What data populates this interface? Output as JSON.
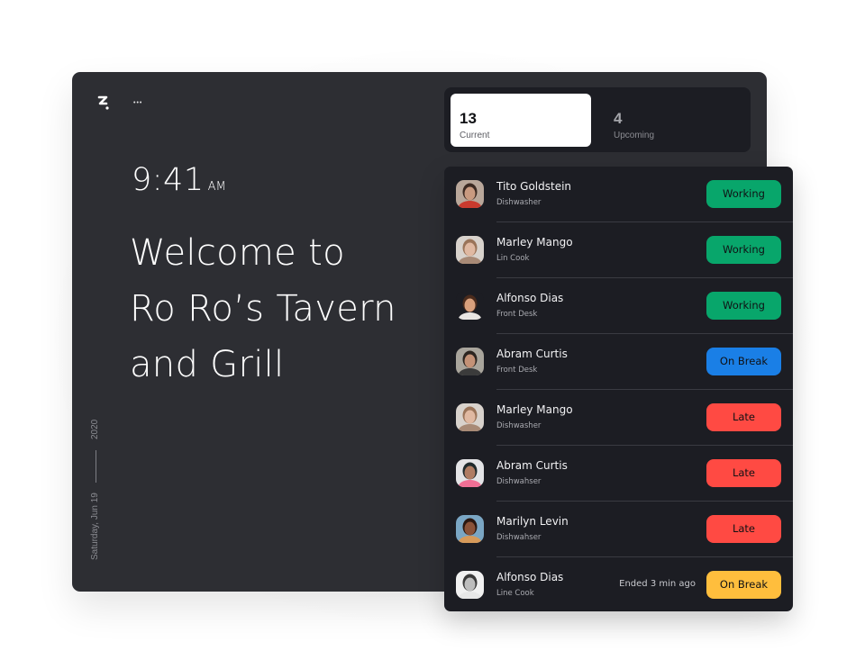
{
  "app": {
    "logo_icon": "brand-logo-icon",
    "menu_icon": "more-horizontal-icon",
    "menu_label": "•••"
  },
  "clock": {
    "time": "9:41",
    "ampm": "AM"
  },
  "welcome": {
    "line1": "Welcome to",
    "line2": "Ro Ro’s Tavern",
    "line3": "and Grill"
  },
  "date": {
    "year": "2020",
    "day": "Saturday, Jun 19"
  },
  "tabs": [
    {
      "count": "13",
      "label": "Current",
      "selected": true
    },
    {
      "count": "4",
      "label": "Upcoming",
      "selected": false
    }
  ],
  "status_colors": {
    "Working": "#08a66b",
    "On Break (blue)": "#1a7fe6",
    "Late": "#ff4a43",
    "On Break (yellow)": "#ffbe3d"
  },
  "staff": [
    {
      "name": "Tito Goldstein",
      "role": "Dishwasher",
      "meta": "",
      "status": "Working",
      "color": "#08a66b",
      "avatar": {
        "bg": "#b9a79a",
        "skin": "#c99a80",
        "hair": "#3c2a22",
        "shirt": "#c93a2e"
      }
    },
    {
      "name": "Marley Mango",
      "role": "Lin Cook",
      "meta": "",
      "status": "Working",
      "color": "#08a66b",
      "avatar": {
        "bg": "#d8d2cc",
        "skin": "#e0b9a2",
        "hair": "#9a7459",
        "shirt": "#a88a76"
      }
    },
    {
      "name": "Alfonso Dias",
      "role": "Front Desk",
      "meta": "",
      "status": "Working",
      "color": "#08a66b",
      "avatar": {
        "bg": "#1c1d23",
        "skin": "#d9a07c",
        "hair": "#4a2b1c",
        "shirt": "#e9e6e3"
      }
    },
    {
      "name": "Abram Curtis",
      "role": "Front Desk",
      "meta": "",
      "status": "On Break",
      "color": "#1a7fe6",
      "avatar": {
        "bg": "#a9a59c",
        "skin": "#c49277",
        "hair": "#2c2520",
        "shirt": "#3b3b3b"
      }
    },
    {
      "name": "Marley Mango",
      "role": "Dishwasher",
      "meta": "",
      "status": "Late",
      "color": "#ff4a43",
      "avatar": {
        "bg": "#d8d2cc",
        "skin": "#e0b9a2",
        "hair": "#9a7459",
        "shirt": "#a88a76"
      }
    },
    {
      "name": "Abram Curtis",
      "role": "Dishwahser",
      "meta": "",
      "status": "Late",
      "color": "#ff4a43",
      "avatar": {
        "bg": "#e4e4e6",
        "skin": "#b07c62",
        "hair": "#1f2a2c",
        "shirt": "#f06f95"
      }
    },
    {
      "name": "Marilyn Levin",
      "role": "Dishwahser",
      "meta": "",
      "status": "Late",
      "color": "#ff4a43",
      "avatar": {
        "bg": "#7aa6c4",
        "skin": "#8a5238",
        "hair": "#2a1710",
        "shirt": "#d79a5a"
      }
    },
    {
      "name": "Alfonso Dias",
      "role": "Line Cook",
      "meta": "Ended 3 min ago",
      "status": "On Break",
      "color": "#ffbe3d",
      "avatar": {
        "bg": "#f1f1f1",
        "skin": "#bdbdbd",
        "hair": "#3a3a3a",
        "shirt": "#e7e7e7"
      }
    }
  ]
}
